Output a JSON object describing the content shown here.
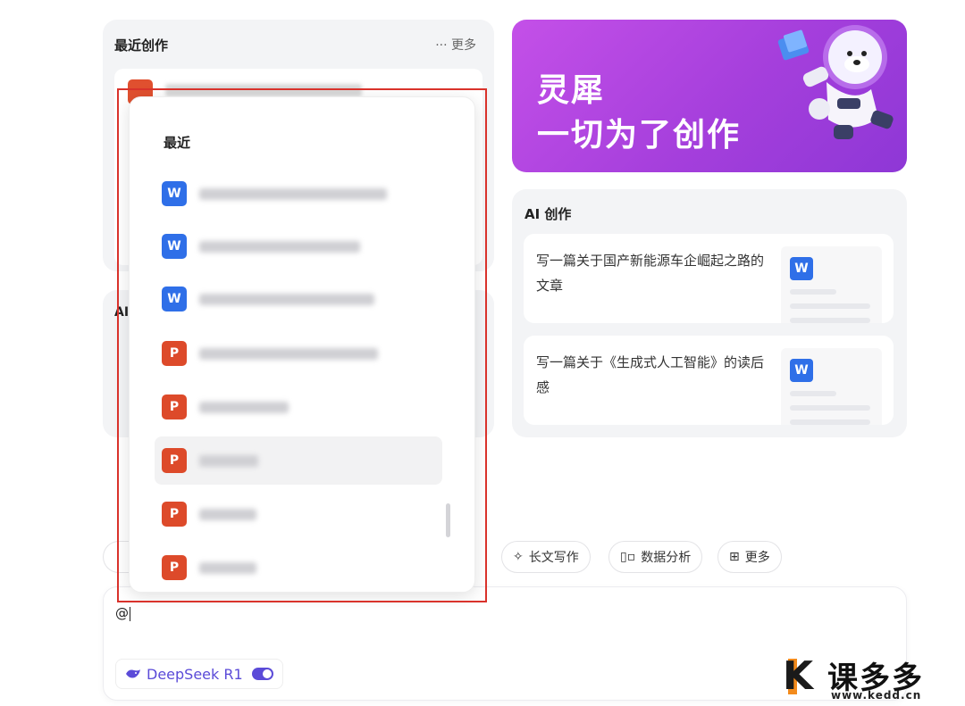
{
  "recent_card": {
    "title": "最近创作",
    "more_label": "··· 更多"
  },
  "ai_left_fragment": "AI",
  "banner": {
    "line1": "灵犀",
    "line2": "一切为了创作"
  },
  "ai_creation": {
    "title": "AI 创作",
    "prompts": [
      {
        "text": "写一篇关于国产新能源车企崛起之路的文章",
        "icon": "W"
      },
      {
        "text": "写一篇关于《生成式人工智能》的读后感",
        "icon": "W"
      }
    ]
  },
  "chips": [
    {
      "icon": "✧",
      "label": "长文写作"
    },
    {
      "icon": "▯▫",
      "label": "数据分析"
    },
    {
      "icon": "⊞",
      "label": "更多"
    }
  ],
  "input": {
    "value": "@",
    "model_label": "DeepSeek R1"
  },
  "popup": {
    "heading": "最近",
    "files": [
      {
        "type": "word",
        "icon": "W"
      },
      {
        "type": "word",
        "icon": "W"
      },
      {
        "type": "word",
        "icon": "W"
      },
      {
        "type": "ppt",
        "icon": "P"
      },
      {
        "type": "ppt",
        "icon": "P"
      },
      {
        "type": "ppt",
        "icon": "P"
      },
      {
        "type": "ppt",
        "icon": "P"
      },
      {
        "type": "ppt",
        "icon": "P"
      }
    ]
  },
  "watermark": {
    "brand": "课多多",
    "url": "www.kedd.cn"
  },
  "colors": {
    "accent": "#5b4bd8",
    "banner": "#a53fdc",
    "highlight_border": "#d9322b",
    "word": "#2f6fe8",
    "ppt": "#dd4a2a"
  }
}
